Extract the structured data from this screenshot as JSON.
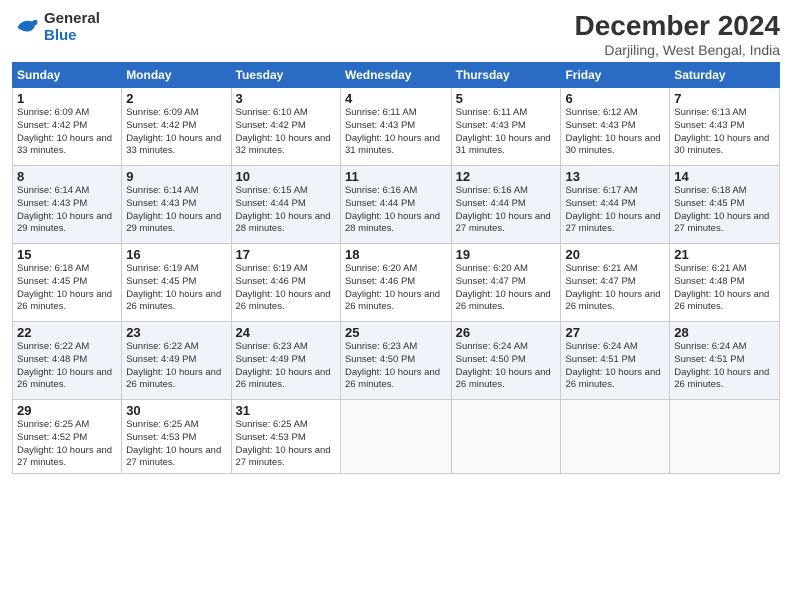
{
  "logo": {
    "line1": "General",
    "line2": "Blue"
  },
  "title": "December 2024",
  "location": "Darjiling, West Bengal, India",
  "headers": [
    "Sunday",
    "Monday",
    "Tuesday",
    "Wednesday",
    "Thursday",
    "Friday",
    "Saturday"
  ],
  "weeks": [
    [
      {
        "day": "1",
        "sunrise": "6:09 AM",
        "sunset": "4:42 PM",
        "daylight": "10 hours and 33 minutes."
      },
      {
        "day": "2",
        "sunrise": "6:09 AM",
        "sunset": "4:42 PM",
        "daylight": "10 hours and 33 minutes."
      },
      {
        "day": "3",
        "sunrise": "6:10 AM",
        "sunset": "4:42 PM",
        "daylight": "10 hours and 32 minutes."
      },
      {
        "day": "4",
        "sunrise": "6:11 AM",
        "sunset": "4:43 PM",
        "daylight": "10 hours and 31 minutes."
      },
      {
        "day": "5",
        "sunrise": "6:11 AM",
        "sunset": "4:43 PM",
        "daylight": "10 hours and 31 minutes."
      },
      {
        "day": "6",
        "sunrise": "6:12 AM",
        "sunset": "4:43 PM",
        "daylight": "10 hours and 30 minutes."
      },
      {
        "day": "7",
        "sunrise": "6:13 AM",
        "sunset": "4:43 PM",
        "daylight": "10 hours and 30 minutes."
      }
    ],
    [
      {
        "day": "8",
        "sunrise": "6:14 AM",
        "sunset": "4:43 PM",
        "daylight": "10 hours and 29 minutes."
      },
      {
        "day": "9",
        "sunrise": "6:14 AM",
        "sunset": "4:43 PM",
        "daylight": "10 hours and 29 minutes."
      },
      {
        "day": "10",
        "sunrise": "6:15 AM",
        "sunset": "4:44 PM",
        "daylight": "10 hours and 28 minutes."
      },
      {
        "day": "11",
        "sunrise": "6:16 AM",
        "sunset": "4:44 PM",
        "daylight": "10 hours and 28 minutes."
      },
      {
        "day": "12",
        "sunrise": "6:16 AM",
        "sunset": "4:44 PM",
        "daylight": "10 hours and 27 minutes."
      },
      {
        "day": "13",
        "sunrise": "6:17 AM",
        "sunset": "4:44 PM",
        "daylight": "10 hours and 27 minutes."
      },
      {
        "day": "14",
        "sunrise": "6:18 AM",
        "sunset": "4:45 PM",
        "daylight": "10 hours and 27 minutes."
      }
    ],
    [
      {
        "day": "15",
        "sunrise": "6:18 AM",
        "sunset": "4:45 PM",
        "daylight": "10 hours and 26 minutes."
      },
      {
        "day": "16",
        "sunrise": "6:19 AM",
        "sunset": "4:45 PM",
        "daylight": "10 hours and 26 minutes."
      },
      {
        "day": "17",
        "sunrise": "6:19 AM",
        "sunset": "4:46 PM",
        "daylight": "10 hours and 26 minutes."
      },
      {
        "day": "18",
        "sunrise": "6:20 AM",
        "sunset": "4:46 PM",
        "daylight": "10 hours and 26 minutes."
      },
      {
        "day": "19",
        "sunrise": "6:20 AM",
        "sunset": "4:47 PM",
        "daylight": "10 hours and 26 minutes."
      },
      {
        "day": "20",
        "sunrise": "6:21 AM",
        "sunset": "4:47 PM",
        "daylight": "10 hours and 26 minutes."
      },
      {
        "day": "21",
        "sunrise": "6:21 AM",
        "sunset": "4:48 PM",
        "daylight": "10 hours and 26 minutes."
      }
    ],
    [
      {
        "day": "22",
        "sunrise": "6:22 AM",
        "sunset": "4:48 PM",
        "daylight": "10 hours and 26 minutes."
      },
      {
        "day": "23",
        "sunrise": "6:22 AM",
        "sunset": "4:49 PM",
        "daylight": "10 hours and 26 minutes."
      },
      {
        "day": "24",
        "sunrise": "6:23 AM",
        "sunset": "4:49 PM",
        "daylight": "10 hours and 26 minutes."
      },
      {
        "day": "25",
        "sunrise": "6:23 AM",
        "sunset": "4:50 PM",
        "daylight": "10 hours and 26 minutes."
      },
      {
        "day": "26",
        "sunrise": "6:24 AM",
        "sunset": "4:50 PM",
        "daylight": "10 hours and 26 minutes."
      },
      {
        "day": "27",
        "sunrise": "6:24 AM",
        "sunset": "4:51 PM",
        "daylight": "10 hours and 26 minutes."
      },
      {
        "day": "28",
        "sunrise": "6:24 AM",
        "sunset": "4:51 PM",
        "daylight": "10 hours and 26 minutes."
      }
    ],
    [
      {
        "day": "29",
        "sunrise": "6:25 AM",
        "sunset": "4:52 PM",
        "daylight": "10 hours and 27 minutes."
      },
      {
        "day": "30",
        "sunrise": "6:25 AM",
        "sunset": "4:53 PM",
        "daylight": "10 hours and 27 minutes."
      },
      {
        "day": "31",
        "sunrise": "6:25 AM",
        "sunset": "4:53 PM",
        "daylight": "10 hours and 27 minutes."
      },
      null,
      null,
      null,
      null
    ]
  ]
}
